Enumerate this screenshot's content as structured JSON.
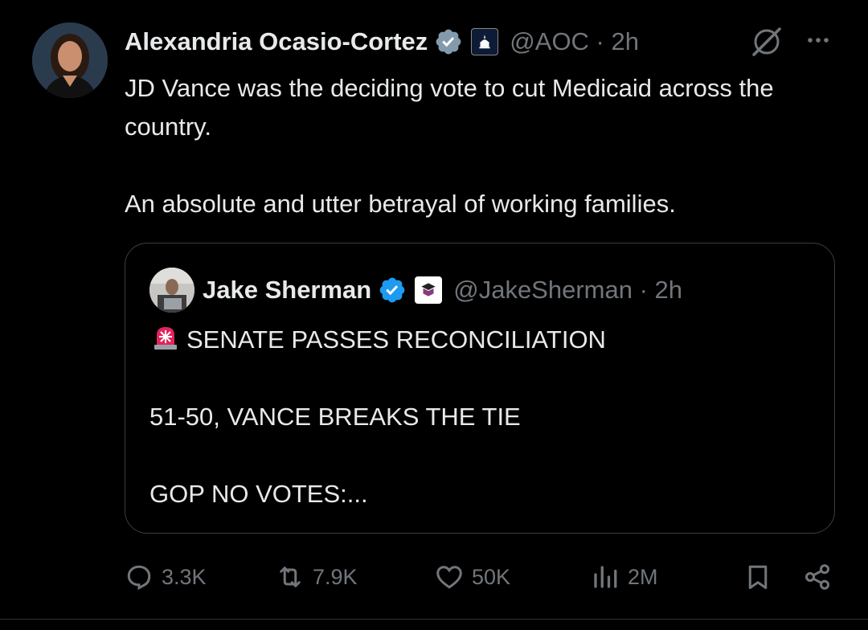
{
  "post": {
    "author_name": "Alexandria Ocasio-Cortez",
    "handle_time": "@AOC · 2h",
    "text_lines": [
      "JD Vance was the deciding vote to cut Medicaid across the country.",
      "An absolute and utter betrayal of working families."
    ]
  },
  "quoted_post": {
    "author_name": "Jake Sherman",
    "handle_time": "@JakeSherman · 2h",
    "line_1": "SENATE PASSES RECONCILIATION",
    "line_2": "51-50, VANCE BREAKS THE TIE",
    "line_3": "GOP NO VOTES:..."
  },
  "actions": {
    "replies": "3.3K",
    "reposts": "7.9K",
    "likes": "50K",
    "views": "2M"
  },
  "colors": {
    "background": "#000000",
    "text": "#e7e9ea",
    "muted": "#71767b",
    "verified_blue": "#1d9bf0",
    "government_gray": "#829aab"
  },
  "icons": [
    "reply-icon",
    "repost-icon",
    "like-icon",
    "views-icon",
    "bookmark-icon",
    "share-icon",
    "grok-icon",
    "more-icon",
    "siren-icon"
  ]
}
